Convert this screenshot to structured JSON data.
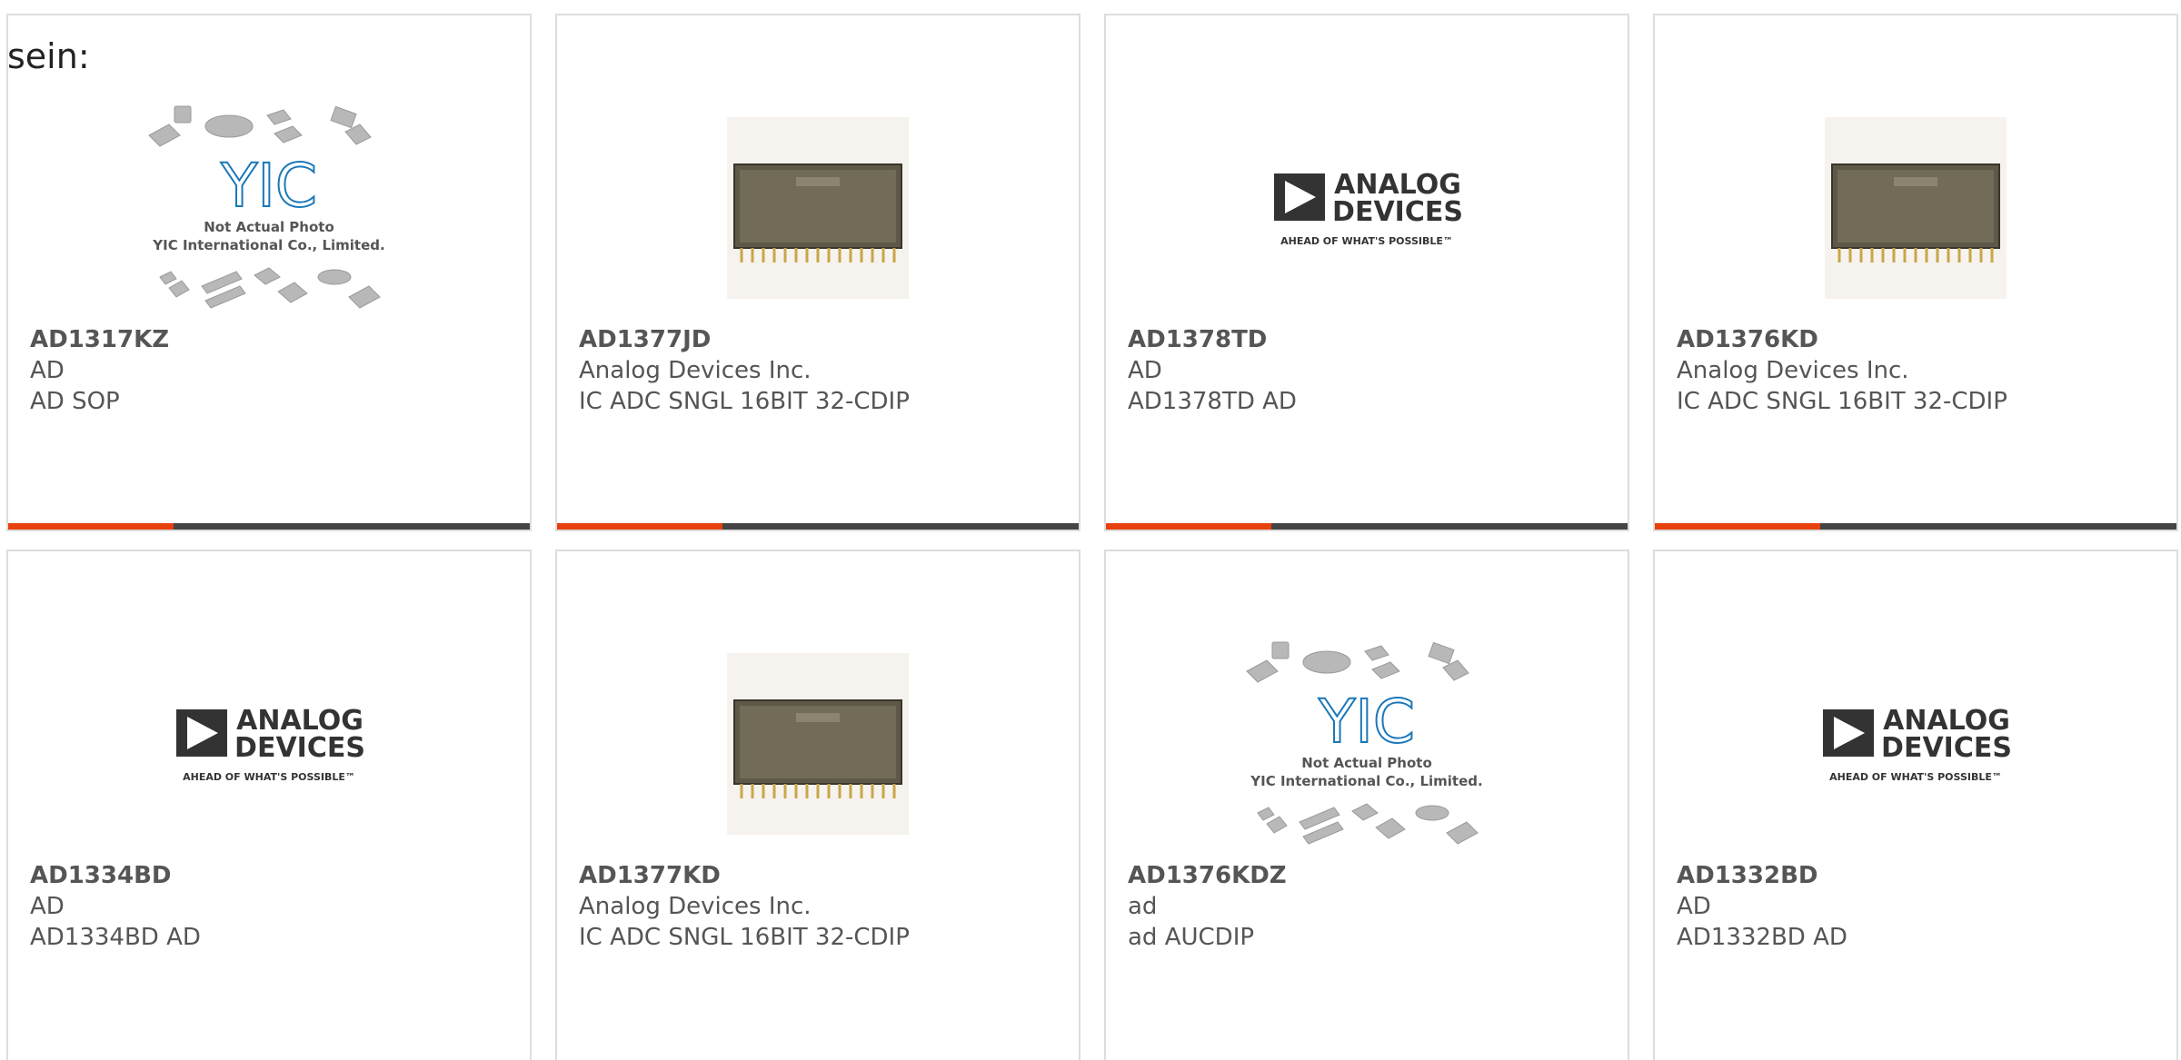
{
  "lead_text": "sein:",
  "brand": {
    "adi_line1": "ANALOG",
    "adi_line2": "DEVICES",
    "adi_tagline": "AHEAD OF WHAT'S POSSIBLE™",
    "yic_logo": "YIC",
    "yic_note1": "Not Actual Photo",
    "yic_note2": "YIC International Co., Limited."
  },
  "colors": {
    "accent": "#e8400c",
    "bar": "#444444",
    "text": "#555555"
  },
  "products": [
    {
      "part": "AD1317KZ",
      "maker": "AD",
      "desc": "AD SOP",
      "image": "placeholder-photo"
    },
    {
      "part": "AD1377JD",
      "maker": "Analog Devices Inc.",
      "desc": "IC ADC SNGL 16BIT 32-CDIP",
      "image": "chip-photo"
    },
    {
      "part": "AD1378TD",
      "maker": "AD",
      "desc": "AD1378TD AD",
      "image": "adi-logo"
    },
    {
      "part": "AD1376KD",
      "maker": "Analog Devices Inc.",
      "desc": "IC ADC SNGL 16BIT 32-CDIP",
      "image": "chip-photo"
    },
    {
      "part": "AD1334BD",
      "maker": "AD",
      "desc": "AD1334BD AD",
      "image": "adi-logo"
    },
    {
      "part": "AD1377KD",
      "maker": "Analog Devices Inc.",
      "desc": "IC ADC SNGL 16BIT 32-CDIP",
      "image": "chip-photo"
    },
    {
      "part": "AD1376KDZ",
      "maker": "ad",
      "desc": "ad AUCDIP",
      "image": "placeholder-photo"
    },
    {
      "part": "AD1332BD",
      "maker": "AD",
      "desc": "AD1332BD AD",
      "image": "adi-logo"
    }
  ]
}
